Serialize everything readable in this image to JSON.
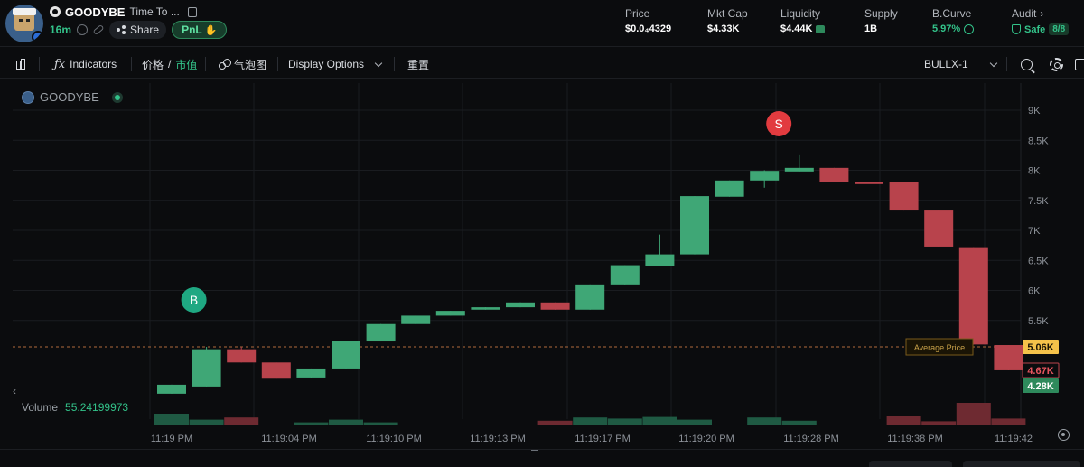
{
  "token": {
    "symbol": "GOODYBE",
    "name": "Time To ...",
    "age": "16m",
    "share_label": "Share",
    "pnl_label": "PnL"
  },
  "stats": [
    {
      "label": "Price",
      "value": "$0.0₄4329"
    },
    {
      "label": "Mkt Cap",
      "value": "$4.33K"
    },
    {
      "label": "Liquidity",
      "value": "$4.44K"
    },
    {
      "label": "Supply",
      "value": "1B"
    },
    {
      "label": "B.Curve",
      "value": "5.97%"
    },
    {
      "label": "Audit",
      "value": "Safe",
      "badge": "8/8"
    }
  ],
  "toolbar": {
    "indicators": "Indicators",
    "price_label": "价格",
    "divider": "/",
    "mcap_label": "市值",
    "bubble_label": "气泡图",
    "display_options": "Display Options",
    "reset_label": "重置",
    "provider": "BULLX-1"
  },
  "chart_data": {
    "type": "candlestick",
    "symbol": "GOODYBE",
    "y_axis": {
      "min": 4000,
      "max": 9000,
      "ticks": [
        "9K",
        "8.5K",
        "8K",
        "7.5K",
        "7K",
        "6.5K",
        "6K",
        "5.5K"
      ],
      "tick_values": [
        9000,
        8500,
        8000,
        7500,
        7000,
        6500,
        6000,
        5500
      ]
    },
    "x_axis_labels": [
      "11:19 PM",
      "11:19:04 PM",
      "11:19:10 PM",
      "11:19:13 PM",
      "11:19:17 PM",
      "11:19:20 PM",
      "11:19:28 PM",
      "11:19:38 PM",
      "11:19:42"
    ],
    "candles": [
      {
        "o": 4280,
        "h": 4430,
        "l": 4280,
        "c": 4430
      },
      {
        "o": 4400,
        "h": 5060,
        "l": 4400,
        "c": 5020
      },
      {
        "o": 5020,
        "h": 5060,
        "l": 4800,
        "c": 4800
      },
      {
        "o": 4800,
        "h": 4800,
        "l": 4530,
        "c": 4530
      },
      {
        "o": 4550,
        "h": 4700,
        "l": 4550,
        "c": 4700
      },
      {
        "o": 4700,
        "h": 5160,
        "l": 4700,
        "c": 5160
      },
      {
        "o": 5150,
        "h": 5440,
        "l": 5150,
        "c": 5440
      },
      {
        "o": 5440,
        "h": 5580,
        "l": 5440,
        "c": 5580
      },
      {
        "o": 5580,
        "h": 5660,
        "l": 5580,
        "c": 5660
      },
      {
        "o": 5680,
        "h": 5720,
        "l": 5680,
        "c": 5720
      },
      {
        "o": 5720,
        "h": 5800,
        "l": 5720,
        "c": 5800
      },
      {
        "o": 5800,
        "h": 5800,
        "l": 5680,
        "c": 5680
      },
      {
        "o": 5680,
        "h": 6100,
        "l": 5680,
        "c": 6100
      },
      {
        "o": 6100,
        "h": 6420,
        "l": 6100,
        "c": 6420
      },
      {
        "o": 6410,
        "h": 6930,
        "l": 6410,
        "c": 6600
      },
      {
        "o": 6600,
        "h": 7570,
        "l": 6600,
        "c": 7570
      },
      {
        "o": 7560,
        "h": 7830,
        "l": 7560,
        "c": 7830
      },
      {
        "o": 7830,
        "h": 8000,
        "l": 7710,
        "c": 7990
      },
      {
        "o": 7980,
        "h": 8250,
        "l": 7980,
        "c": 8040
      },
      {
        "o": 8040,
        "h": 8040,
        "l": 7810,
        "c": 7810
      },
      {
        "o": 7800,
        "h": 7800,
        "l": 7780,
        "c": 7780
      },
      {
        "o": 7800,
        "h": 7800,
        "l": 7330,
        "c": 7330
      },
      {
        "o": 7330,
        "h": 7330,
        "l": 6730,
        "c": 6730
      },
      {
        "o": 6720,
        "h": 6720,
        "l": 5100,
        "c": 5100
      },
      {
        "o": 5090,
        "h": 5090,
        "l": 4670,
        "c": 4670
      }
    ],
    "volumes": [
      1.0,
      0.45,
      0.65,
      0,
      0.2,
      0.45,
      0.2,
      0,
      0,
      0,
      0,
      0.35,
      0.65,
      0.55,
      0.7,
      0.45,
      0,
      0.65,
      0.35,
      0,
      0,
      0.8,
      0.3,
      2.0,
      0.55
    ],
    "markers": [
      {
        "label": "B",
        "candle": 1,
        "side": "buy"
      },
      {
        "label": "S",
        "candle": 17,
        "side": "sell"
      }
    ],
    "average_price": {
      "label": "Average Price",
      "value": 5060
    },
    "price_tags": [
      {
        "label": "5.06K",
        "value": 5060,
        "kind": "average"
      },
      {
        "label": "4.67K",
        "value": 4670,
        "kind": "last"
      },
      {
        "label": "4.28K",
        "value": 4280,
        "kind": "low"
      }
    ],
    "volume_label": "Volume",
    "volume_value": "55.24199973"
  },
  "colors": {
    "up": "#3fa776",
    "down": "#b8434c",
    "background": "#0b0c0e",
    "grid": "#1a1c20",
    "accent_green": "#33c38a",
    "average_line": "#b06a3c"
  }
}
